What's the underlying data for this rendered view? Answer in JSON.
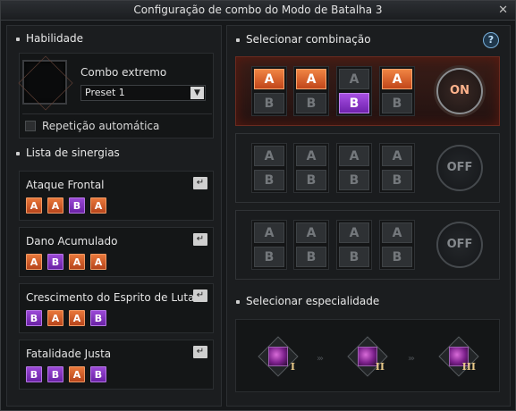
{
  "window": {
    "title": "Configuração de combo do Modo de Batalha 3",
    "close_icon": "✕"
  },
  "skill": {
    "section_title": "Habilidade",
    "name": "Combo extremo",
    "preset": "Preset 1",
    "dropdown_icon": "▼",
    "auto_repeat_label": "Repetição automática",
    "auto_repeat_checked": false
  },
  "synergy": {
    "section_title": "Lista de sinergias",
    "enter_icon": "↵",
    "items": [
      {
        "name": "Ataque Frontal",
        "seq": [
          "A",
          "A",
          "B",
          "A"
        ]
      },
      {
        "name": "Dano Acumulado",
        "seq": [
          "A",
          "B",
          "A",
          "A"
        ]
      },
      {
        "name": "Crescimento do Esprito de Luta",
        "seq": [
          "B",
          "A",
          "A",
          "B"
        ]
      },
      {
        "name": "Fatalidade Justa",
        "seq": [
          "B",
          "B",
          "A",
          "B"
        ]
      }
    ]
  },
  "combos": {
    "section_title": "Selecionar combinação",
    "help_icon": "?",
    "rows": [
      {
        "state": "ON",
        "active": true,
        "selected": [
          "A",
          "A",
          "B",
          "A"
        ]
      },
      {
        "state": "OFF",
        "active": false,
        "selected": [
          null,
          null,
          null,
          null
        ]
      },
      {
        "state": "OFF",
        "active": false,
        "selected": [
          null,
          null,
          null,
          null
        ]
      }
    ],
    "letter_a": "A",
    "letter_b": "B"
  },
  "specialty": {
    "section_title": "Selecionar especialidade",
    "separator": "›››",
    "items": [
      {
        "numeral": "I"
      },
      {
        "numeral": "II"
      },
      {
        "numeral": "III"
      }
    ]
  },
  "colors": {
    "accent_orange": "#e9783b",
    "accent_purple": "#9b49d6",
    "active_red": "#6a2a1f"
  }
}
